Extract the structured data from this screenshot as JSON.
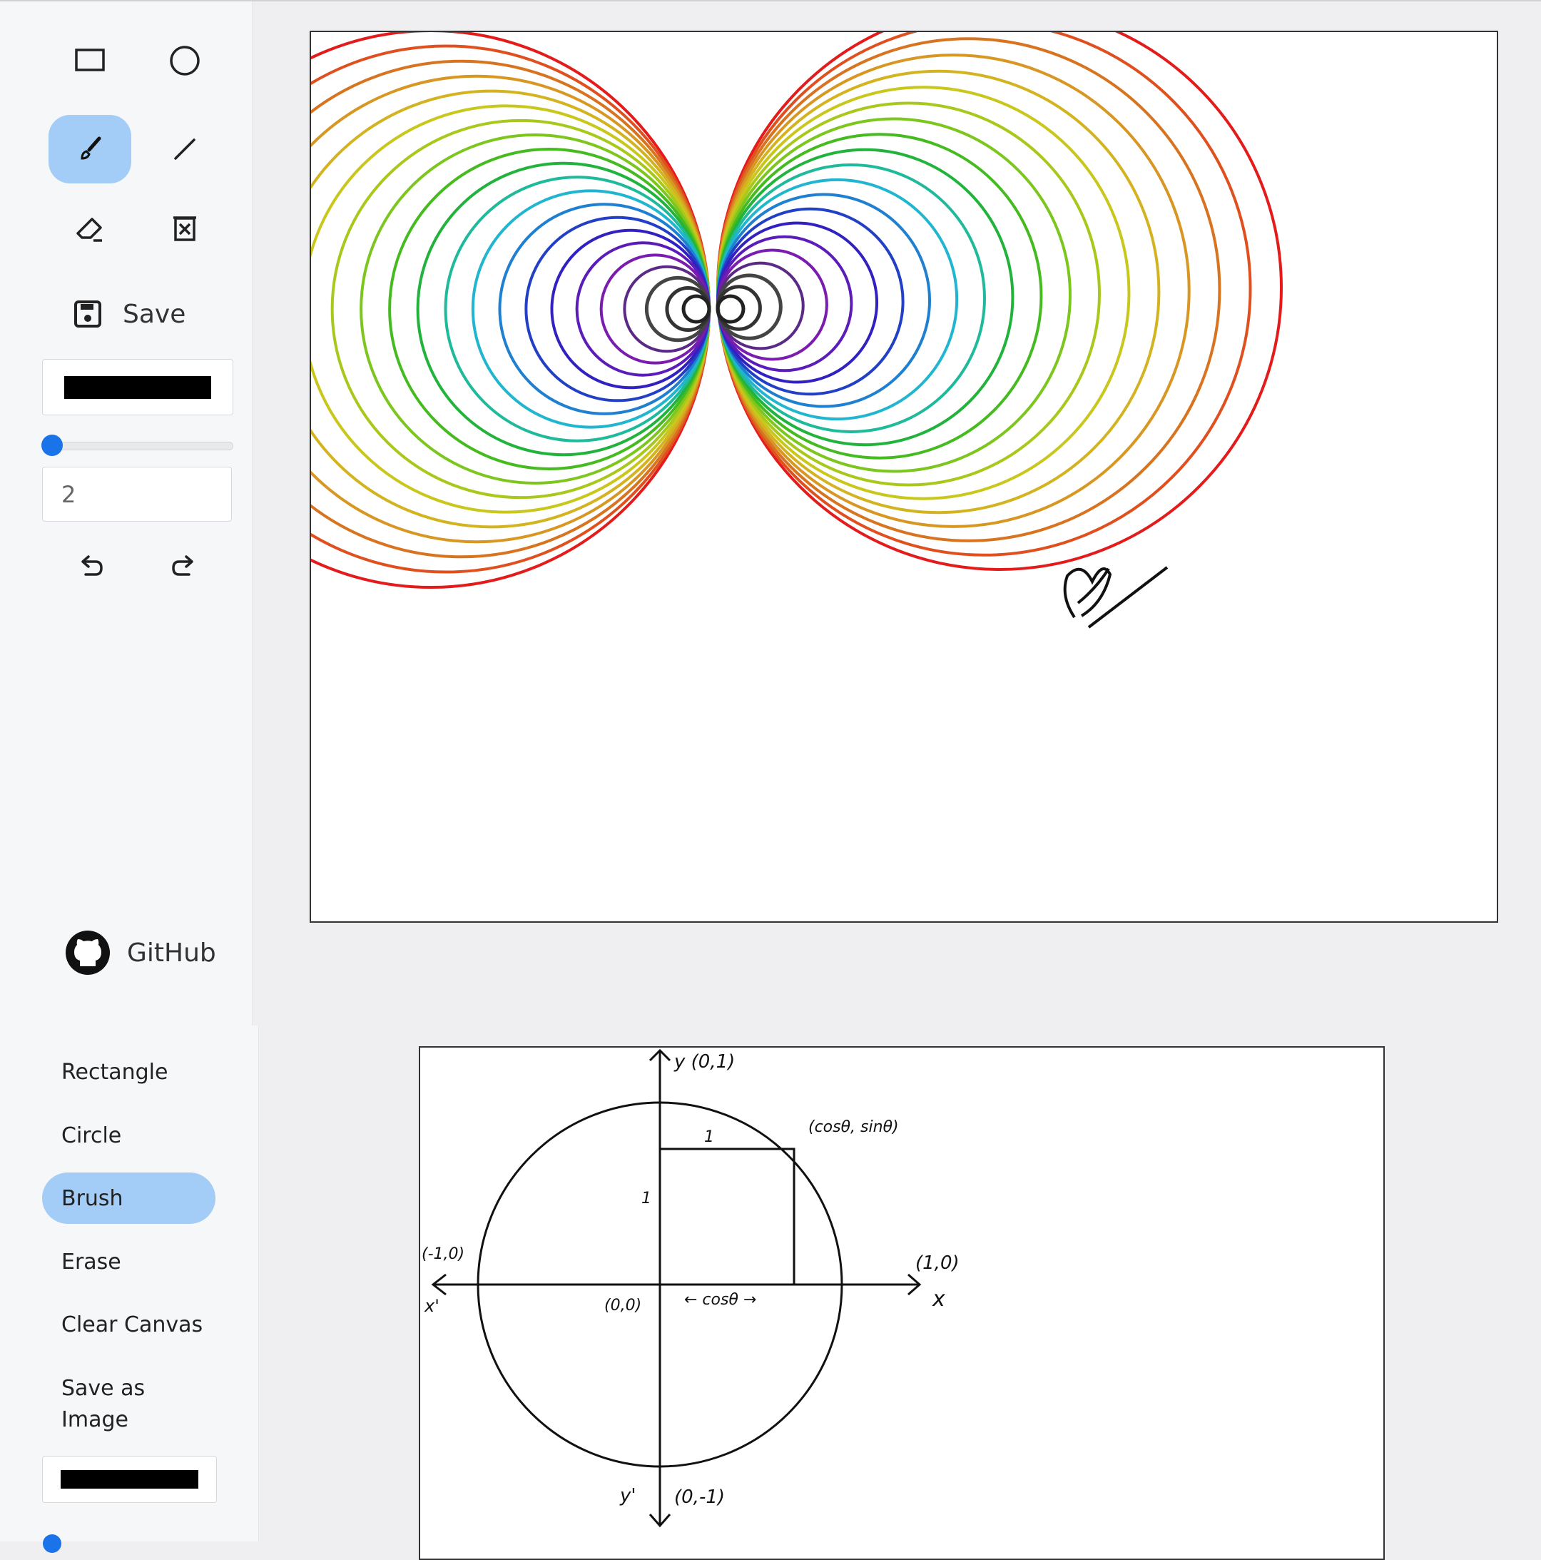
{
  "toolbar": {
    "tools": [
      {
        "name": "rectangle-tool",
        "icon": "rectangle-icon"
      },
      {
        "name": "circle-tool",
        "icon": "circle-icon"
      },
      {
        "name": "brush-tool",
        "icon": "brush-icon",
        "active": true
      },
      {
        "name": "line-tool",
        "icon": "line-icon"
      },
      {
        "name": "eraser-tool",
        "icon": "eraser-icon"
      },
      {
        "name": "clear-tool",
        "icon": "trash-icon"
      }
    ],
    "save_label": "Save",
    "color": "#000000",
    "brush_size": "2",
    "undo_icon": "undo-icon",
    "redo_icon": "redo-icon",
    "github_label": "GitHub",
    "active_color": "#a3cdf6",
    "slider_color": "#1a73e8"
  },
  "menu": {
    "items": [
      {
        "label": "Rectangle"
      },
      {
        "label": "Circle"
      },
      {
        "label": "Brush",
        "active": true
      },
      {
        "label": "Erase"
      },
      {
        "label": "Clear Canvas"
      },
      {
        "label": "Save as Image"
      }
    ],
    "color": "#000000"
  },
  "diagram": {
    "y_axis": "y (0,1)",
    "y_neg": "y'",
    "y_neg_label": "(0,-1)",
    "x_axis": "x",
    "x_neg": "x'",
    "x_pos_label": "(1,0)",
    "x_neg_label": "(-1,0)",
    "origin": "(0,0)",
    "point": "(cosθ, sinθ)",
    "cos_label": "← cosθ →",
    "side_label": "1"
  }
}
